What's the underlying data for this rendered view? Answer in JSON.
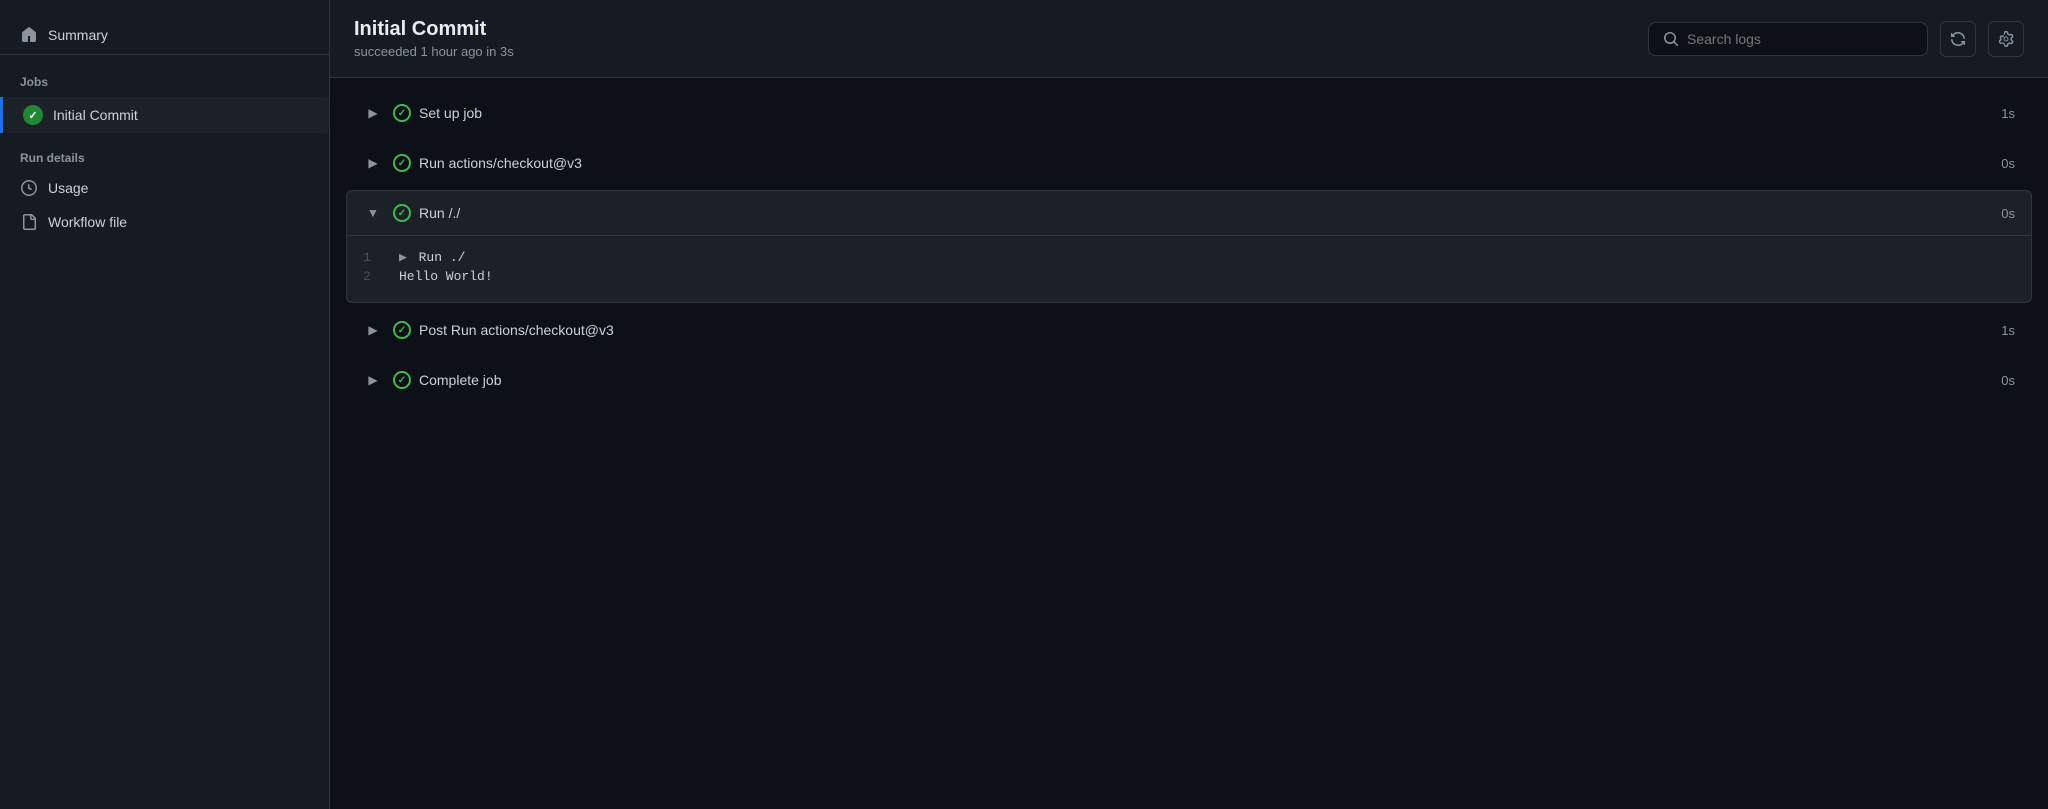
{
  "sidebar": {
    "summary_label": "Summary",
    "jobs_section_label": "Jobs",
    "active_job_label": "Initial Commit",
    "run_details_section_label": "Run details",
    "usage_label": "Usage",
    "workflow_file_label": "Workflow file"
  },
  "header": {
    "title": "Initial Commit",
    "subtitle": "succeeded 1 hour ago in 3s",
    "search_placeholder": "Search logs",
    "refresh_btn_label": "Refresh",
    "settings_btn_label": "Settings"
  },
  "steps": [
    {
      "id": 1,
      "name": "Set up job",
      "duration": "1s",
      "expanded": false,
      "logs": []
    },
    {
      "id": 2,
      "name": "Run actions/checkout@v3",
      "duration": "0s",
      "expanded": false,
      "logs": []
    },
    {
      "id": 3,
      "name": "Run /./",
      "duration": "0s",
      "expanded": true,
      "logs": [
        {
          "line": 1,
          "content": "▶ Run ./"
        },
        {
          "line": 2,
          "content": "Hello World!"
        }
      ]
    },
    {
      "id": 4,
      "name": "Post Run actions/checkout@v3",
      "duration": "1s",
      "expanded": false,
      "logs": []
    },
    {
      "id": 5,
      "name": "Complete job",
      "duration": "0s",
      "expanded": false,
      "logs": []
    }
  ]
}
